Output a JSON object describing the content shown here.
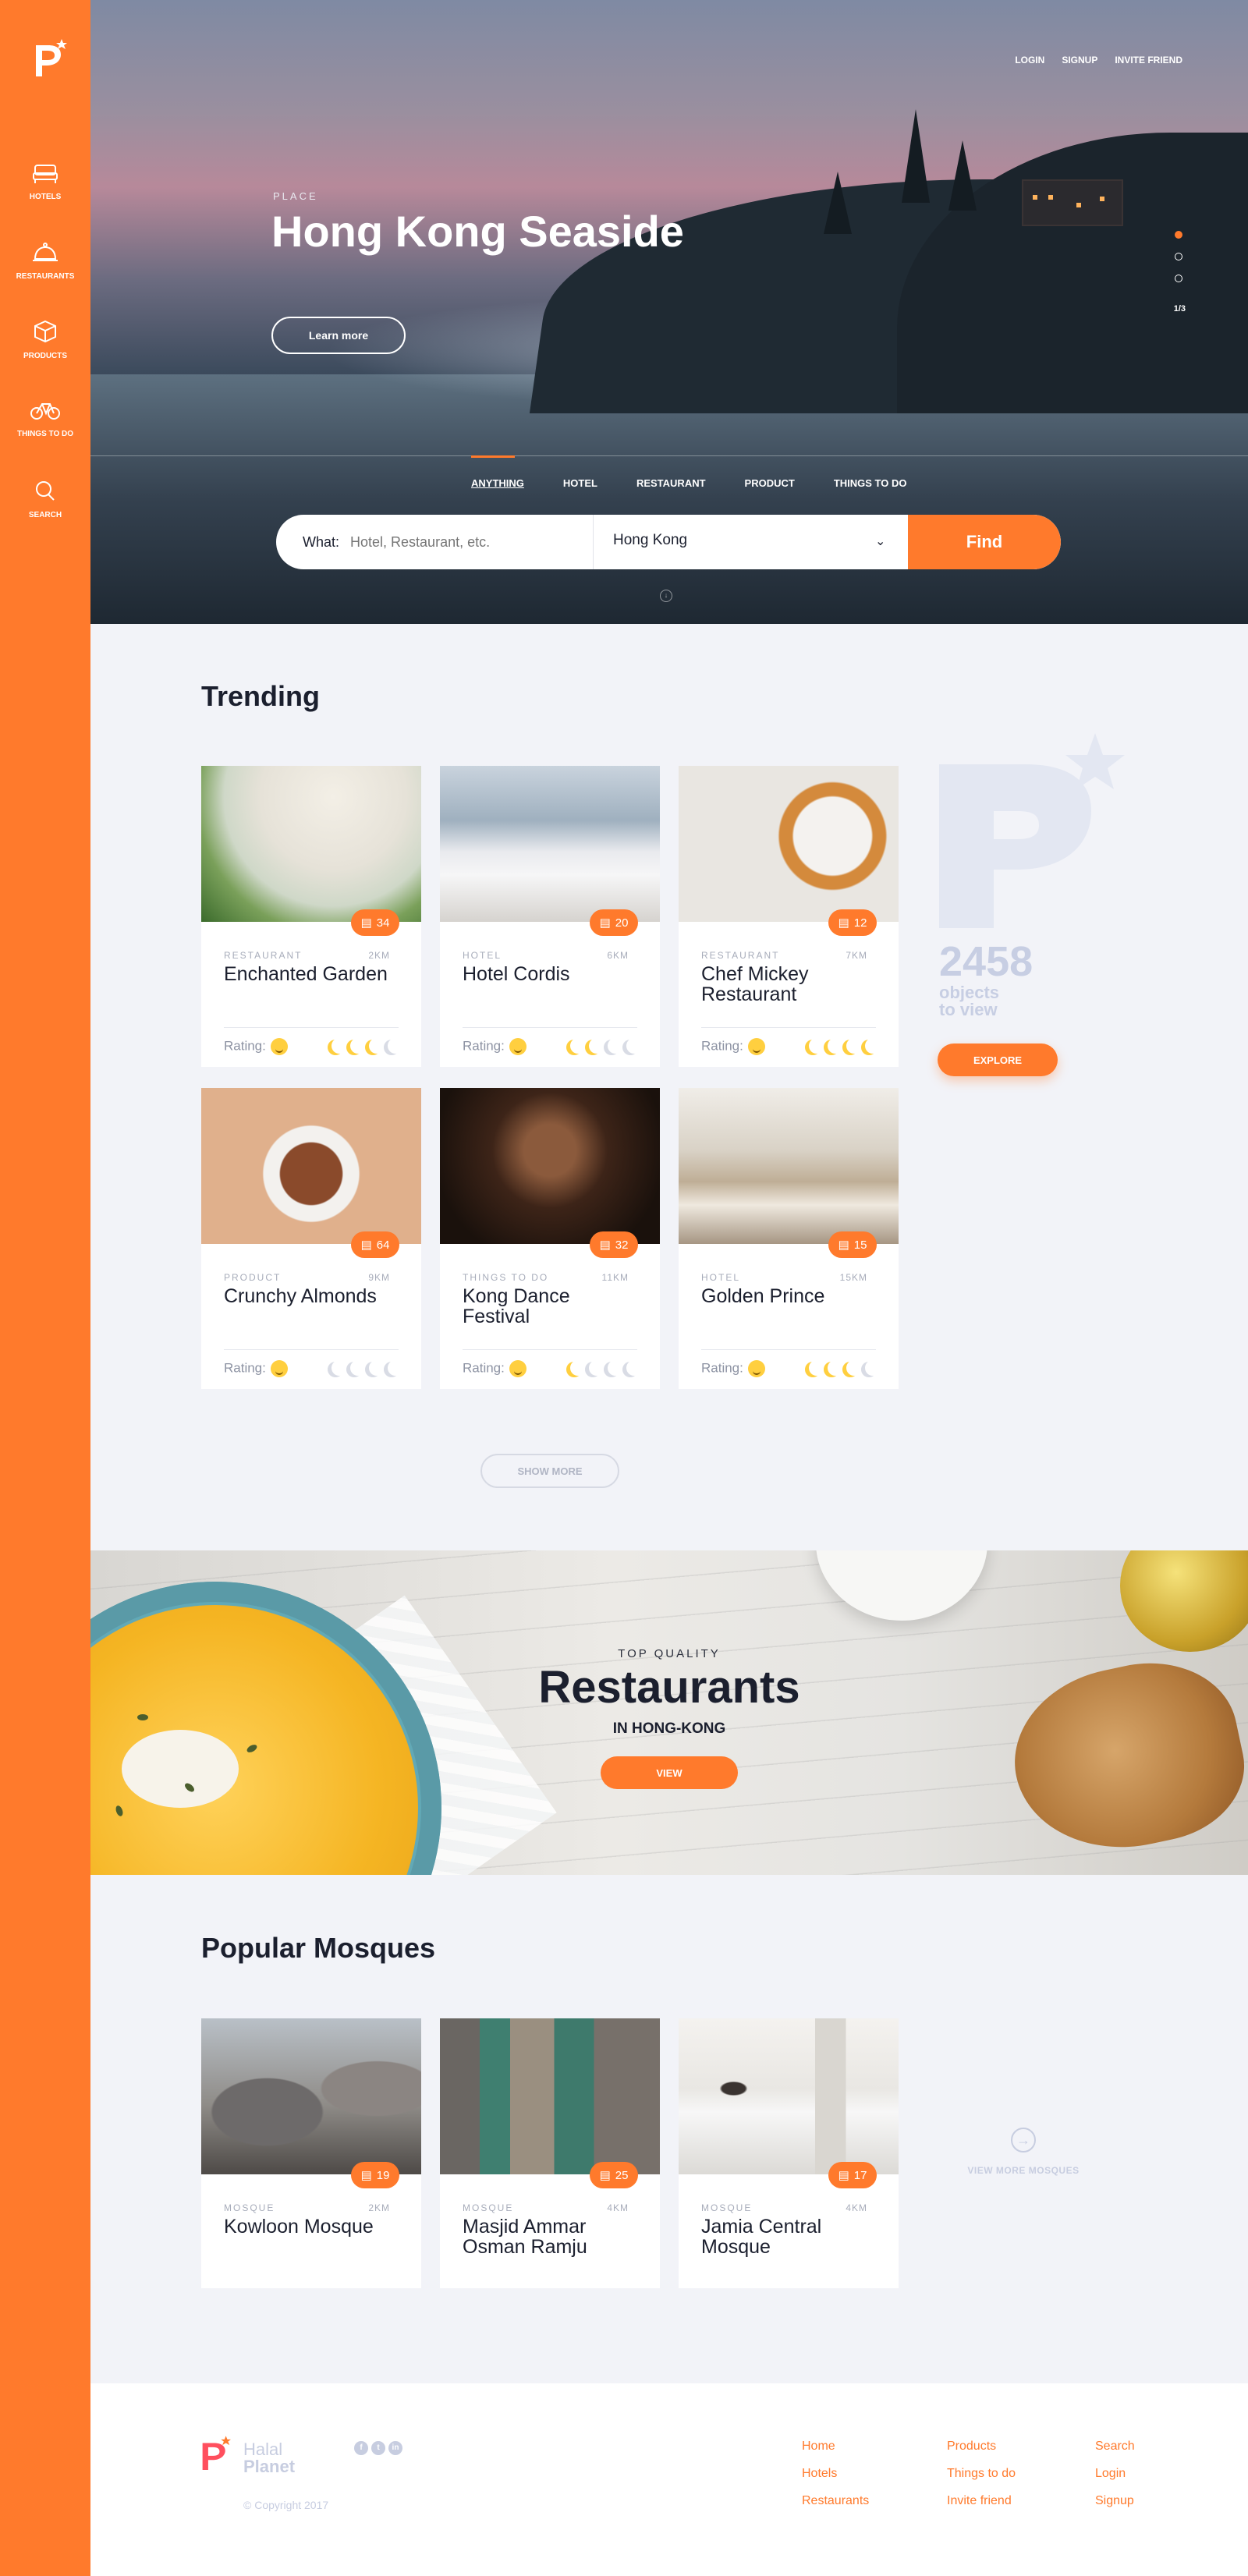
{
  "brand": {
    "accent": "#ff7a2c",
    "logo_letter": "P"
  },
  "sidebar": {
    "items": [
      {
        "label": "HOTELS",
        "icon": "bed-icon"
      },
      {
        "label": "RESTAURANTS",
        "icon": "cloche-icon"
      },
      {
        "label": "PRODUCTS",
        "icon": "box-icon"
      },
      {
        "label": "THINGS TO DO",
        "icon": "bicycle-icon"
      },
      {
        "label": "SEARCH",
        "icon": "search-icon"
      }
    ]
  },
  "top_links": {
    "login": "LOGIN",
    "signup": "SIGNUP",
    "invite": "INVITE FRIEND"
  },
  "hero": {
    "eyebrow": "PLACE",
    "title": "Hong Kong Seaside",
    "cta": "Learn more",
    "slide_counter": "1/3",
    "tabs": [
      "ANYTHING",
      "HOTEL",
      "RESTAURANT",
      "PRODUCT",
      "THINGS TO DO"
    ]
  },
  "search": {
    "what_label": "What:",
    "what_placeholder": "Hotel, Restaurant, etc.",
    "location_value": "Hong Kong",
    "find_label": "Find"
  },
  "trending": {
    "title": "Trending",
    "rating_label": "Rating:",
    "cards": [
      {
        "category": "RESTAURANT",
        "distance": "2KM",
        "name": "Enchanted Garden",
        "comments": "34",
        "rating": 3
      },
      {
        "category": "HOTEL",
        "distance": "6KM",
        "name": "Hotel Cordis",
        "comments": "20",
        "rating": 2
      },
      {
        "category": "RESTAURANT",
        "distance": "7KM",
        "name": "Chef Mickey Restaurant",
        "comments": "12",
        "rating": 4
      },
      {
        "category": "PRODUCT",
        "distance": "9KM",
        "name": "Crunchy Almonds",
        "comments": "64",
        "rating": 0
      },
      {
        "category": "THINGS TO DO",
        "distance": "11KM",
        "name": "Kong Dance Festival",
        "comments": "32",
        "rating": 1
      },
      {
        "category": "HOTEL",
        "distance": "15KM",
        "name": "Golden Prince",
        "comments": "15",
        "rating": 3
      }
    ],
    "show_more": "SHOW MORE",
    "explore": {
      "count": "2458",
      "line1": "objects",
      "line2": "to view",
      "button": "EXPLORE"
    }
  },
  "banner": {
    "eyebrow": "TOP QUALITY",
    "title": "Restaurants",
    "location": "IN HONG-KONG",
    "button": "VIEW"
  },
  "mosques": {
    "title": "Popular Mosques",
    "cards": [
      {
        "category": "MOSQUE",
        "distance": "2KM",
        "name": "Kowloon Mosque",
        "comments": "19"
      },
      {
        "category": "MOSQUE",
        "distance": "4KM",
        "name": "Masjid Ammar Osman Ramju",
        "comments": "25"
      },
      {
        "category": "MOSQUE",
        "distance": "4KM",
        "name": "Jamia Central Mosque",
        "comments": "17"
      }
    ],
    "view_more": "VIEW MORE MOSQUES"
  },
  "footer": {
    "brand_line1": "Halal",
    "brand_line2": "Planet",
    "copyright": "© Copyright 2017",
    "col1": [
      "Home",
      "Hotels",
      "Restaurants"
    ],
    "col2": [
      "Products",
      "Things to do",
      "Invite friend"
    ],
    "col3": [
      "Search",
      "Login",
      "Signup"
    ]
  }
}
